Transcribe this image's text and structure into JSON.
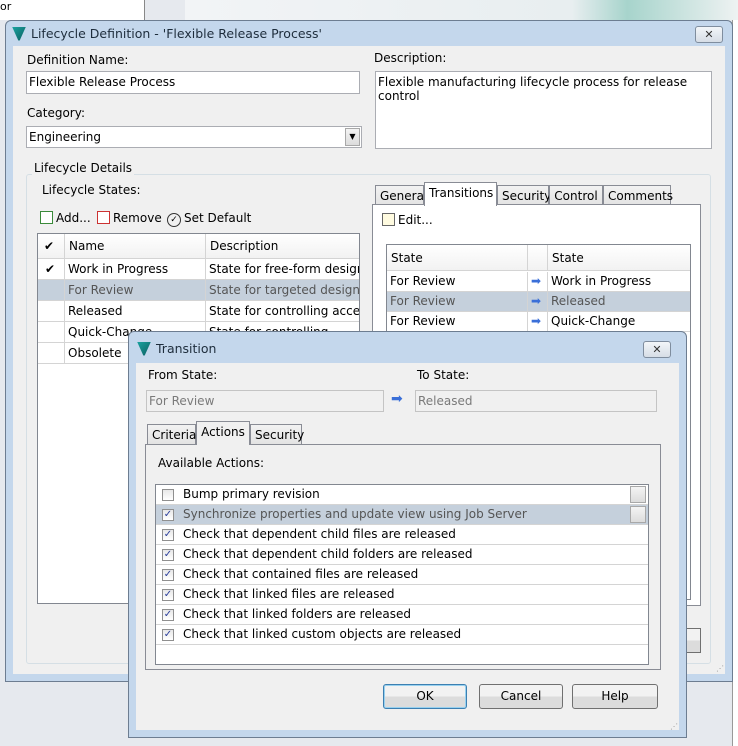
{
  "background": {
    "text": "or"
  },
  "lifecycle_dialog": {
    "title": "Lifecycle Definition - 'Flexible Release Process'",
    "definition_name_label": "Definition Name:",
    "definition_name_value": "Flexible Release Process",
    "description_label": "Description:",
    "description_value": "Flexible manufacturing lifecycle process for release control",
    "category_label": "Category:",
    "category_value": "Engineering",
    "details_group": "Lifecycle Details",
    "states_label": "Lifecycle States:",
    "toolbar": {
      "add": "Add...",
      "remove": "Remove",
      "set_default": "Set Default"
    },
    "states_table": {
      "columns": [
        "✔",
        "Name",
        "Description"
      ],
      "rows": [
        {
          "default": true,
          "name": "Work in Progress",
          "description": "State for free-form design..."
        },
        {
          "default": false,
          "name": "For Review",
          "description": "State for targeted design r...",
          "selected": true
        },
        {
          "default": false,
          "name": "Released",
          "description": "State for controlling acces..."
        },
        {
          "default": false,
          "name": "Quick-Change",
          "description": "State for controlling..."
        },
        {
          "default": false,
          "name": "Obsolete",
          "description": ""
        }
      ]
    },
    "tabs": [
      "General",
      "Transitions",
      "Security",
      "Control",
      "Comments"
    ],
    "active_tab": "Transitions",
    "edit_label": "Edit...",
    "transitions_table": {
      "columns": [
        "State",
        "",
        "State"
      ],
      "rows": [
        {
          "from": "For Review",
          "to": "Work in Progress"
        },
        {
          "from": "For Review",
          "to": "Released",
          "selected": true
        },
        {
          "from": "For Review",
          "to": "Quick-Change"
        }
      ]
    }
  },
  "transition_dialog": {
    "title": "Transition",
    "from_label": "From State:",
    "from_value": "For Review",
    "to_label": "To State:",
    "to_value": "Released",
    "tabs": [
      "Criteria",
      "Actions",
      "Security"
    ],
    "active_tab": "Actions",
    "available_actions_label": "Available Actions:",
    "actions": [
      {
        "label": "Bump primary revision",
        "checked": false,
        "dropdown": true
      },
      {
        "label": "Synchronize properties and update view using Job Server",
        "checked": true,
        "dropdown": true,
        "selected": true
      },
      {
        "label": "Check that dependent child files are released",
        "checked": true
      },
      {
        "label": "Check that dependent child folders are released",
        "checked": true
      },
      {
        "label": "Check that contained files are released",
        "checked": true
      },
      {
        "label": "Check that linked files are released",
        "checked": true
      },
      {
        "label": "Check that linked folders are released",
        "checked": true
      },
      {
        "label": "Check that linked custom objects are released",
        "checked": true
      }
    ],
    "buttons": {
      "ok": "OK",
      "cancel": "Cancel",
      "help": "Help"
    }
  }
}
